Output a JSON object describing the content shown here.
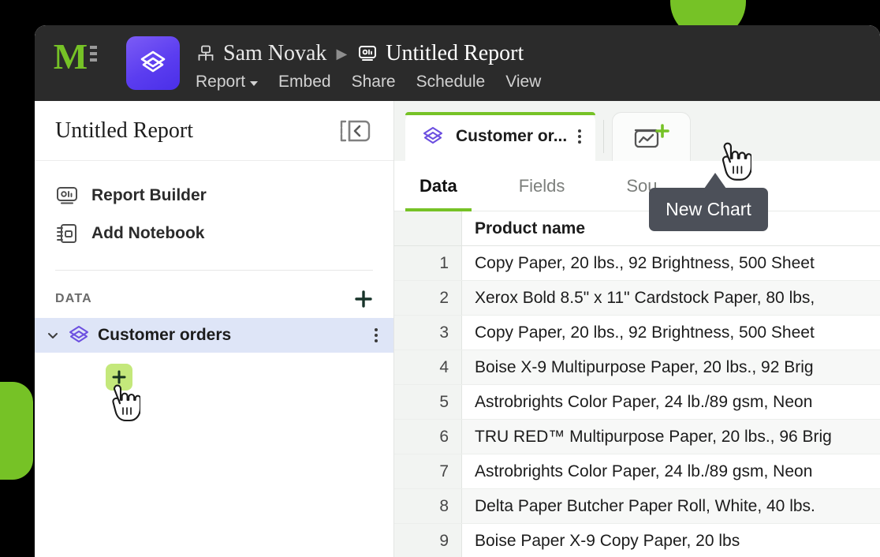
{
  "window": {
    "topbar": {
      "logo_letter": "M",
      "breadcrumb": {
        "user": "Sam Novak",
        "separator": "▶",
        "report": "Untitled Report"
      },
      "nav_items": [
        {
          "label": "Report",
          "has_caret": true
        },
        {
          "label": "Embed",
          "has_caret": false
        },
        {
          "label": "Share",
          "has_caret": false
        },
        {
          "label": "Schedule",
          "has_caret": false
        },
        {
          "label": "View",
          "has_caret": false
        }
      ]
    }
  },
  "sidebar": {
    "title": "Untitled Report",
    "collapse_icon": "collapse-panel-icon",
    "links": [
      {
        "label": "Report Builder",
        "icon": "report-builder-icon"
      },
      {
        "label": "Add Notebook",
        "icon": "notebook-icon"
      }
    ],
    "section": {
      "title": "DATA",
      "add_icon": "plus-icon"
    },
    "datasets": [
      {
        "label": "Customer orders",
        "icon": "dataset-icon",
        "menu_icon": "kebab-menu-icon",
        "expanded": true
      }
    ],
    "add_chip_icon": "plus-icon"
  },
  "main": {
    "tabs": [
      {
        "label": "Customer or...",
        "icon": "dataset-icon",
        "menu_icon": "kebab-menu-icon",
        "active": true
      }
    ],
    "new_tab": {
      "icon": "new-chart-icon",
      "tooltip": "New Chart"
    },
    "subtabs": [
      {
        "label": "Data",
        "active": true
      },
      {
        "label": "Fields",
        "active": false
      },
      {
        "label": "Sou",
        "active": false
      }
    ],
    "table": {
      "columns": [
        "",
        "Product name"
      ],
      "rows": [
        {
          "num": "1",
          "product_name": "Copy Paper, 20 lbs., 92 Brightness, 500 Sheet"
        },
        {
          "num": "2",
          "product_name": "Xerox Bold 8.5\" x 11\" Cardstock Paper, 80 lbs,"
        },
        {
          "num": "3",
          "product_name": "Copy Paper, 20 lbs., 92 Brightness, 500 Sheet"
        },
        {
          "num": "4",
          "product_name": "Boise X-9 Multipurpose Paper, 20 lbs., 92 Brig"
        },
        {
          "num": "5",
          "product_name": "Astrobrights Color Paper, 24 lb./89 gsm, Neon"
        },
        {
          "num": "6",
          "product_name": "TRU RED™ Multipurpose Paper, 20 lbs., 96 Brig"
        },
        {
          "num": "7",
          "product_name": "Astrobrights Color Paper, 24 lb./89 gsm, Neon"
        },
        {
          "num": "8",
          "product_name": "Delta Paper Butcher Paper Roll, White, 40 lbs."
        },
        {
          "num": "9",
          "product_name": "Boise Paper X-9 Copy Paper, 20 lbs"
        }
      ]
    }
  },
  "colors": {
    "brand_green": "#76c226",
    "brand_purple": "#5b3df0",
    "tooltip_bg": "#4c5059",
    "topbar_bg": "#2b2b2b",
    "selected_row_bg": "#dee5f7",
    "chip_green": "#c4e87b"
  }
}
